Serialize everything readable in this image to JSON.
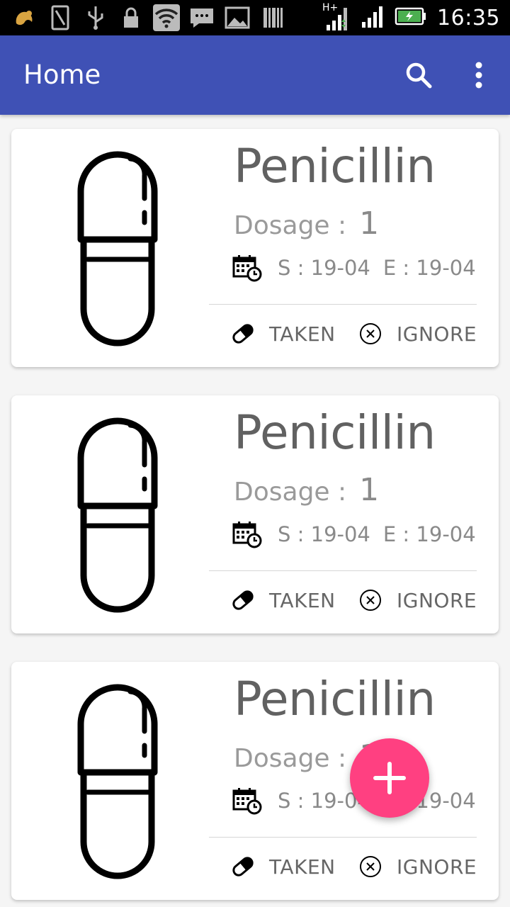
{
  "status_bar": {
    "time": "16:35",
    "network": "H+",
    "icons": [
      "uc-browser-icon",
      "sim-icon",
      "usb-icon",
      "lock-icon",
      "wifi-icon",
      "message-icon",
      "image-icon",
      "barcode-icon",
      "signal-icon",
      "battery-charging-icon"
    ]
  },
  "appbar": {
    "title": "Home",
    "color": "#3f51b5",
    "actions": [
      "search-icon",
      "more-vert-icon"
    ]
  },
  "medications": [
    {
      "name": "Penicillin",
      "dosage_label": "Dosage :",
      "dosage_value": "1",
      "start": "S : 19-04",
      "end": "E : 19-04",
      "taken_label": "TAKEN",
      "ignore_label": "IGNORE"
    },
    {
      "name": "Penicillin",
      "dosage_label": "Dosage :",
      "dosage_value": "1",
      "start": "S : 19-04",
      "end": "E : 19-04",
      "taken_label": "TAKEN",
      "ignore_label": "IGNORE"
    },
    {
      "name": "Penicillin",
      "dosage_label": "Dosage :",
      "dosage_value": "1",
      "start": "S : 19-04",
      "end": "E : 19-04",
      "taken_label": "TAKEN",
      "ignore_label": "IGNORE"
    }
  ],
  "fab": {
    "icon": "add-icon",
    "color": "#ff4081"
  }
}
